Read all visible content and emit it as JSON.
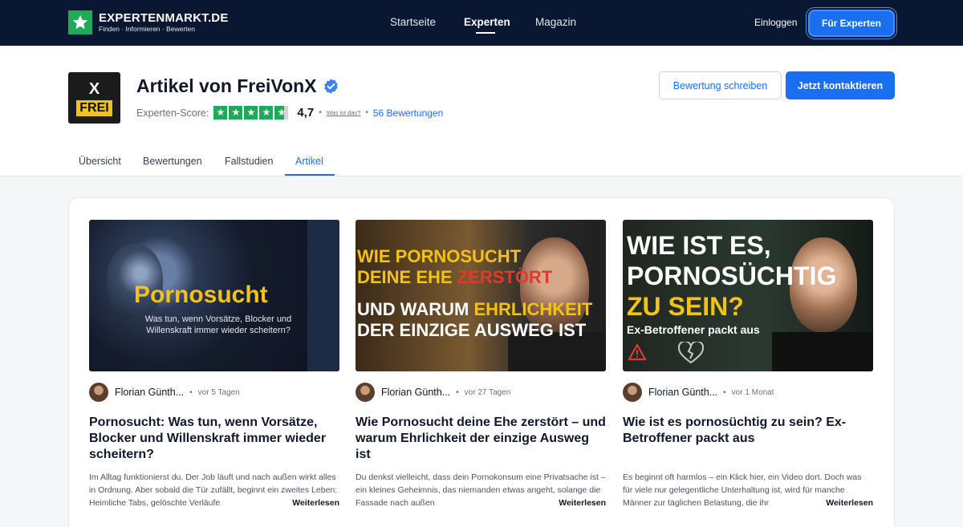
{
  "brand": {
    "name": "EXPERTENMARKT.DE",
    "tagline": "Finden · Informieren · Bewerten"
  },
  "nav": {
    "links": [
      "Startseite",
      "Experten",
      "Magazin"
    ],
    "active": "Experten",
    "login": "Einloggen",
    "cta": "Für Experten"
  },
  "profile": {
    "avatar_text_top": "X",
    "avatar_text_bottom": "FREI",
    "title": "Artikel von FreiVonX",
    "score_label": "Experten-Score:",
    "score": "4,7",
    "what_is_this": "Was ist das?",
    "reviews": "56 Bewertungen",
    "btn_write": "Bewertung schreiben",
    "btn_contact": "Jetzt kontaktieren"
  },
  "tabs": [
    "Übersicht",
    "Bewertungen",
    "Fallstudien",
    "Artikel"
  ],
  "active_tab": "Artikel",
  "articles": [
    {
      "thumb_title": "Pornosucht",
      "thumb_subtitle": "Was tun, wenn Vorsätze, Blocker und Willenskraft immer wieder scheitern?",
      "author": "Florian Günth...",
      "time": "vor 5 Tagen",
      "title": "Pornosucht: Was tun, wenn Vorsätze, Blocker und Willenskraft immer wieder scheitern?",
      "excerpt": "Im Alltag funktionierst du. Der Job läuft und nach außen wirkt alles in Ordnung. Aber sobald die Tür zufällt, beginnt ein zweites Leben: Heimliche Tabs, gelöschte Verläufe",
      "read_more": "Weiterlesen"
    },
    {
      "thumb_line1": "WIE PORNOSUCHT",
      "thumb_line2a": "DEINE EHE ",
      "thumb_line2b": "ZERSTÖRT",
      "thumb_line3a": "UND WARUM ",
      "thumb_line3b": "EHRLICHKEIT",
      "thumb_line4": "DER EINZIGE AUSWEG IST",
      "author": "Florian Günth...",
      "time": "vor 27 Tagen",
      "title": "Wie Pornosucht deine Ehe zerstört – und warum Ehrlichkeit der einzige Ausweg ist",
      "excerpt": "Du denkst vielleicht, dass dein Pornokonsum eine Privatsache ist – ein kleines Geheimnis, das niemanden etwas angeht, solange die Fassade nach außen",
      "read_more": "Weiterlesen"
    },
    {
      "thumb_line1": "WIE IST ES,",
      "thumb_line2": "PORNOSÜCHTIG",
      "thumb_line3": "ZU SEIN?",
      "thumb_line4": "Ex-Betroffener packt aus",
      "author": "Florian Günth...",
      "time": "vor 1 Monat",
      "title": "Wie ist es pornosüchtig zu sein? Ex-Betroffener packt aus",
      "excerpt": "Es beginnt oft harmlos – ein Klick hier, ein Video dort. Doch was für viele nur gelegentliche Unterhaltung ist, wird für manche Männer zur täglichen Belastung, die ihr",
      "read_more": "Weiterlesen"
    }
  ],
  "colors": {
    "nav_bg": "#0a1733",
    "accent": "#1a6ff0",
    "trust_green": "#1fa95b",
    "thumb_yellow": "#f2c21b"
  }
}
